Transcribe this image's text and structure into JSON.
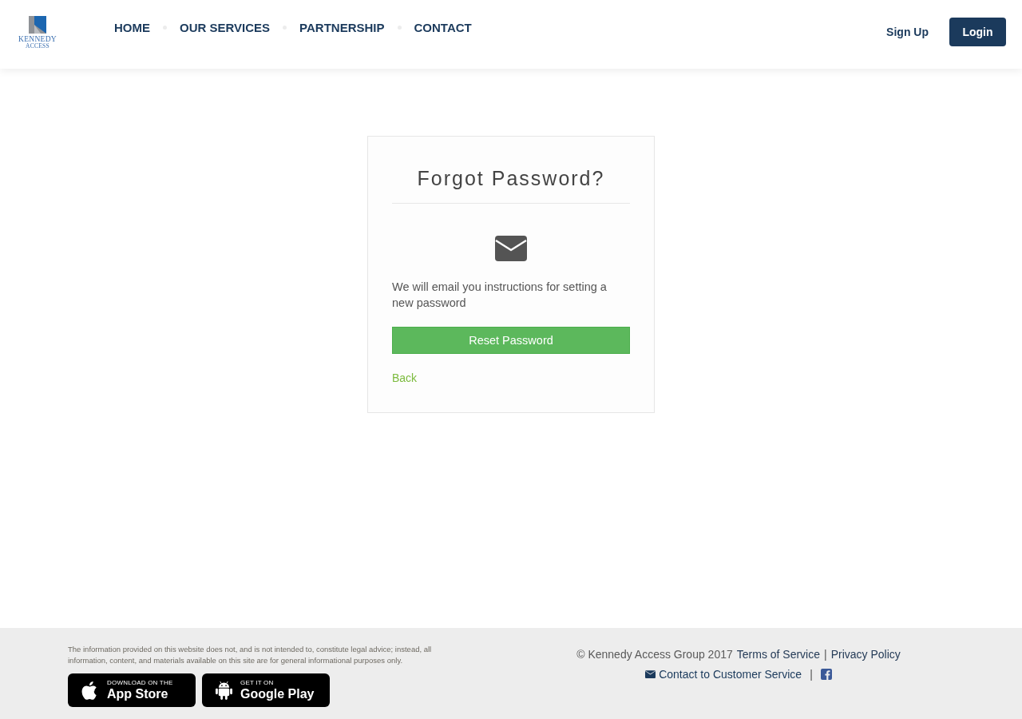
{
  "header": {
    "logo": {
      "line_1": "KENNEDY",
      "line_2": "ACCESS"
    },
    "nav": [
      {
        "label": "HOME"
      },
      {
        "label": "OUR SERVICES"
      },
      {
        "label": "PARTNERSHIP"
      },
      {
        "label": "CONTACT"
      }
    ],
    "sign_up": "Sign Up",
    "login": "Login"
  },
  "card": {
    "title": "Forgot Password?",
    "message": "We will email you instructions for setting a new password",
    "button": "Reset Password",
    "back_link": "Back"
  },
  "footer": {
    "disclaimer": "The information provided on this website does not, and is not intended to, constitute legal advice; instead, all information, content, and materials available on this site are for general informational purposes only.",
    "store_badges": [
      {
        "kind": "apple",
        "small_text": "DOWNLOAD ON THE",
        "large_text": "App Store"
      },
      {
        "kind": "android",
        "small_text": "GET IT ON",
        "large_text": "Google Play"
      }
    ],
    "legal_line": {
      "copyright": "© Kennedy Access Group 2017",
      "terms_link": "Terms of Service",
      "separator": "|",
      "privacy_link": "Privacy Policy"
    },
    "contact_line": {
      "contact_link": "Contact to Customer Service",
      "separator": "|"
    }
  }
}
